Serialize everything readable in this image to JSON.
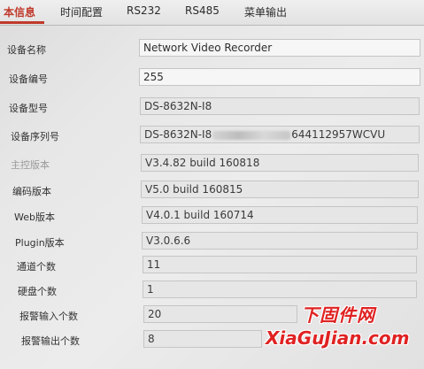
{
  "tabs": [
    {
      "label": "本信息"
    },
    {
      "label": "时间配置"
    },
    {
      "label": "RS232"
    },
    {
      "label": "RS485"
    },
    {
      "label": "菜单输出"
    }
  ],
  "fields": {
    "device_name": {
      "label": "设备名称",
      "value": "Network Video Recorder"
    },
    "device_number": {
      "label": "设备编号",
      "value": "255"
    },
    "device_model": {
      "label": "设备型号",
      "value": "DS-8632N-I8"
    },
    "serial": {
      "label": "设备序列号",
      "prefix": "DS-8632N-I8",
      "suffix": "644112957WCVU"
    },
    "main_version": {
      "label": "主控版本",
      "value": "V3.4.82 build 160818"
    },
    "encode_version": {
      "label": "编码版本",
      "value": "V5.0 build 160815"
    },
    "web_version": {
      "label": "Web版本",
      "value": "V4.0.1 build 160714"
    },
    "plugin_version": {
      "label": "Plugin版本",
      "value": "V3.0.6.6"
    },
    "channels": {
      "label": "通道个数",
      "value": "11"
    },
    "disks": {
      "label": "硬盘个数",
      "value": "1"
    },
    "alarm_in": {
      "label": "报警输入个数",
      "value": "20"
    },
    "alarm_out": {
      "label": "报警输出个数",
      "value": "8"
    }
  },
  "watermark": {
    "cn": "下固件网",
    "en": "XiaGuJian.com",
    "color": "#e02222"
  },
  "colors": {
    "active_tab": "#c0392b"
  }
}
